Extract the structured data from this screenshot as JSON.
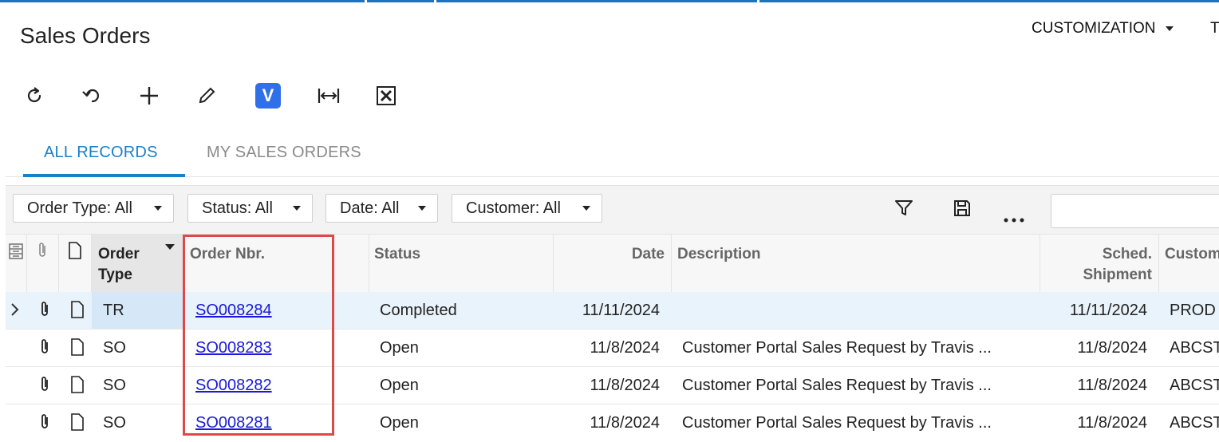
{
  "page": {
    "title": "Sales Orders"
  },
  "header": {
    "customization_label": "CUSTOMIZATION",
    "truncated_menu_label": "T"
  },
  "toolbar": {
    "icons": [
      "refresh-icon",
      "undo-icon",
      "add-icon",
      "edit-icon",
      "v-icon",
      "fit-columns-icon",
      "excel-export-icon"
    ],
    "v_label": "V"
  },
  "tabs": [
    {
      "label": "ALL RECORDS",
      "active": true
    },
    {
      "label": "MY SALES ORDERS",
      "active": false
    }
  ],
  "filters": {
    "order_type": "Order Type: All",
    "status": "Status: All",
    "date": "Date: All",
    "customer": "Customer: All"
  },
  "grid": {
    "columns": {
      "order_type": "Order Type",
      "order_type_l1": "Order",
      "order_type_l2": "Type",
      "order_nbr": "Order Nbr.",
      "status": "Status",
      "date": "Date",
      "description": "Description",
      "sched_l1": "Sched.",
      "sched_l2": "Shipment",
      "customer": "Custom"
    },
    "rows": [
      {
        "type": "TR",
        "nbr": "SO008284",
        "status": "Completed",
        "date": "11/11/2024",
        "description": "",
        "sched": "11/11/2024",
        "customer": "PROD"
      },
      {
        "type": "SO",
        "nbr": "SO008283",
        "status": "Open",
        "date": "11/8/2024",
        "description": "Customer Portal Sales Request by Travis ...",
        "sched": "11/8/2024",
        "customer": "ABCST"
      },
      {
        "type": "SO",
        "nbr": "SO008282",
        "status": "Open",
        "date": "11/8/2024",
        "description": "Customer Portal Sales Request by Travis ...",
        "sched": "11/8/2024",
        "customer": "ABCST"
      },
      {
        "type": "SO",
        "nbr": "SO008281",
        "status": "Open",
        "date": "11/8/2024",
        "description": "Customer Portal Sales Request by Travis ...",
        "sched": "11/8/2024",
        "customer": "ABCST"
      }
    ]
  },
  "colors": {
    "accent": "#1a80c7",
    "link": "#1a1ad6",
    "highlight_box": "#e04848",
    "selected_row": "#e9f3fb"
  }
}
